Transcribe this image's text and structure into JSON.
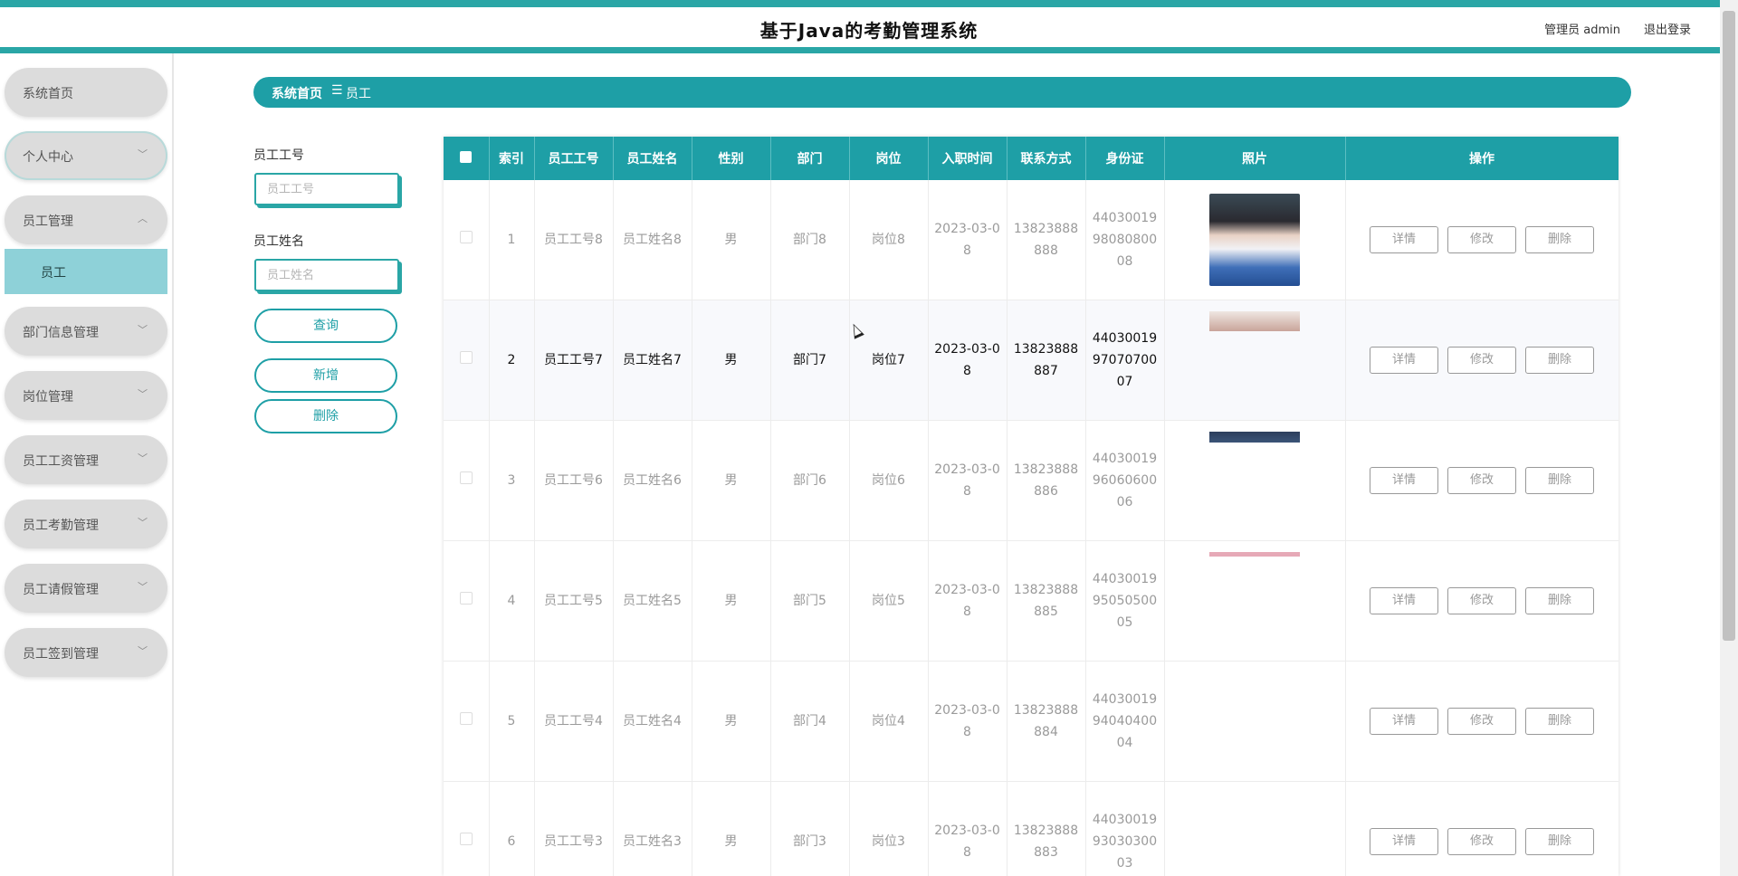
{
  "header": {
    "title": "基于Java的考勤管理系统",
    "user": "管理员 admin",
    "logout": "退出登录"
  },
  "sidebar": {
    "items": [
      {
        "label": "系统首页",
        "chevron": ""
      },
      {
        "label": "个人中心",
        "chevron": "﹀"
      },
      {
        "label": "员工管理",
        "chevron": "︿"
      },
      {
        "label": "部门信息管理",
        "chevron": "﹀"
      },
      {
        "label": "岗位管理",
        "chevron": "﹀"
      },
      {
        "label": "员工工资管理",
        "chevron": "﹀"
      },
      {
        "label": "员工考勤管理",
        "chevron": "﹀"
      },
      {
        "label": "员工请假管理",
        "chevron": "﹀"
      },
      {
        "label": "员工签到管理",
        "chevron": "﹀"
      }
    ],
    "submenu": "员工"
  },
  "breadcrumb": {
    "home": "系统首页",
    "separator": "☰",
    "current": "员工"
  },
  "search": {
    "id_label": "员工工号",
    "id_placeholder": "员工工号",
    "name_label": "员工姓名",
    "name_placeholder": "员工姓名",
    "query_button": "查询",
    "add_button": "新增",
    "delete_button": "删除"
  },
  "table": {
    "columns": [
      "索引",
      "员工工号",
      "员工姓名",
      "性别",
      "部门",
      "岗位",
      "入职时间",
      "联系方式",
      "身份证",
      "照片",
      "操作"
    ],
    "rows": [
      {
        "index": "1",
        "id": "员工工号8",
        "name": "员工姓名8",
        "gender": "男",
        "dept": "部门8",
        "post": "岗位8",
        "date": "2023-03-08",
        "phone": "13823888888",
        "idcard": "440300199808080008"
      },
      {
        "index": "2",
        "id": "员工工号7",
        "name": "员工姓名7",
        "gender": "男",
        "dept": "部门7",
        "post": "岗位7",
        "date": "2023-03-08",
        "phone": "13823888887",
        "idcard": "440300199707070007"
      },
      {
        "index": "3",
        "id": "员工工号6",
        "name": "员工姓名6",
        "gender": "男",
        "dept": "部门6",
        "post": "岗位6",
        "date": "2023-03-08",
        "phone": "13823888886",
        "idcard": "440300199606060006"
      },
      {
        "index": "4",
        "id": "员工工号5",
        "name": "员工姓名5",
        "gender": "男",
        "dept": "部门5",
        "post": "岗位5",
        "date": "2023-03-08",
        "phone": "13823888885",
        "idcard": "440300199505050005"
      },
      {
        "index": "5",
        "id": "员工工号4",
        "name": "员工姓名4",
        "gender": "男",
        "dept": "部门4",
        "post": "岗位4",
        "date": "2023-03-08",
        "phone": "13823888884",
        "idcard": "440300199404040004"
      },
      {
        "index": "6",
        "id": "员工工号3",
        "name": "员工姓名3",
        "gender": "男",
        "dept": "部门3",
        "post": "岗位3",
        "date": "2023-03-08",
        "phone": "13823888883",
        "idcard": "440300199303030003"
      }
    ],
    "actions": {
      "detail": "详情",
      "edit": "修改",
      "delete": "删除"
    }
  },
  "colors": {
    "accent": "#1e9fa6",
    "submenu_active": "#8ed1d8",
    "menu_bg": "#dcdcdc"
  }
}
